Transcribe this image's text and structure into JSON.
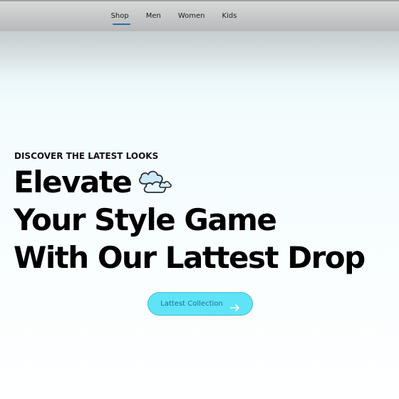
{
  "nav": {
    "items": [
      {
        "label": "Shop",
        "active": true
      },
      {
        "label": "Men",
        "active": false
      },
      {
        "label": "Women",
        "active": false
      },
      {
        "label": "Kids",
        "active": false
      }
    ]
  },
  "hero": {
    "eyebrow": "DISCOVER THE LATEST LOOKS",
    "line1": "Elevate",
    "line2": "Your Style Game",
    "line3": "With Our Lattest Drop",
    "icon": "cloud-icon",
    "cta_label": "Lattest Collection",
    "cta_icon": "arrow-right-icon"
  },
  "colors": {
    "accent": "#5fe3f7",
    "nav_underline": "#2e6da4",
    "cta_text": "#1f6f99"
  }
}
